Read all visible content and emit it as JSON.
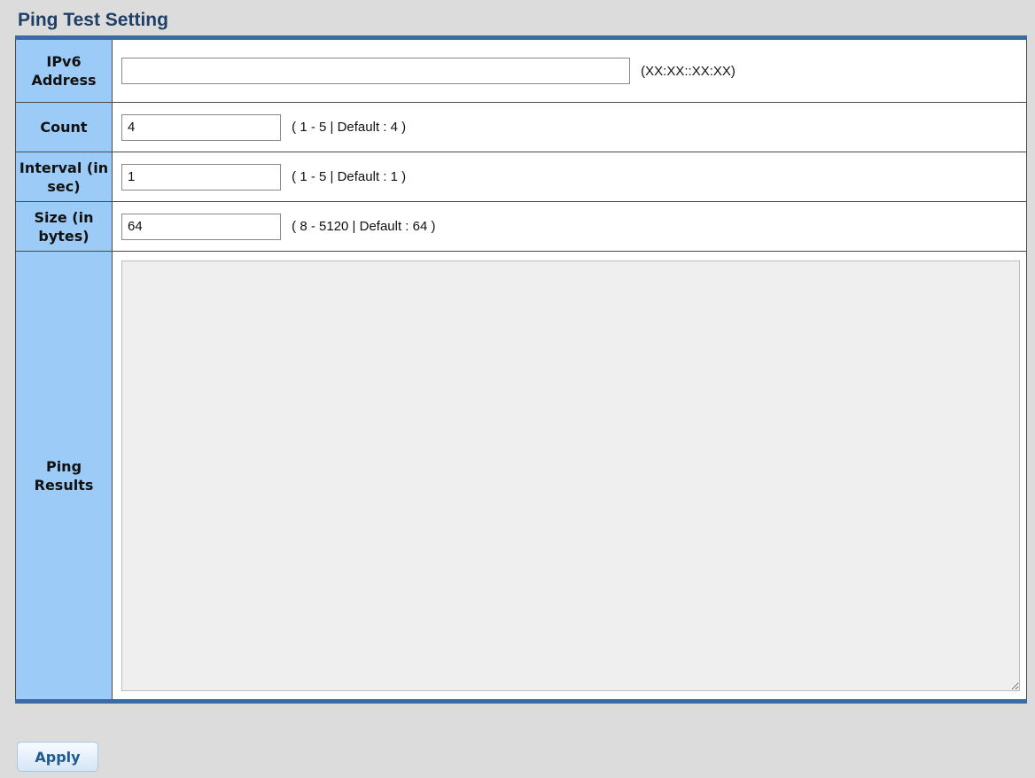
{
  "section": {
    "title": "Ping Test Setting"
  },
  "form": {
    "ipv6": {
      "label": "IPv6 Address",
      "value": "",
      "hint": "(XX:XX::XX:XX)"
    },
    "count": {
      "label": "Count",
      "value": "4",
      "hint": "( 1 - 5 | Default : 4 )"
    },
    "interval": {
      "label": "Interval (in sec)",
      "value": "1",
      "hint": "( 1 - 5 | Default : 1 )"
    },
    "size": {
      "label": "Size (in bytes)",
      "value": "64",
      "hint": "( 8 - 5120 | Default : 64 )"
    },
    "results": {
      "label": "Ping Results",
      "value": ""
    }
  },
  "actions": {
    "apply_label": "Apply"
  },
  "colors": {
    "label_background": "#9ccbf7",
    "table_border": "#3c6aa5",
    "title": "#1f3f66",
    "page_background": "#dcdcdc"
  }
}
